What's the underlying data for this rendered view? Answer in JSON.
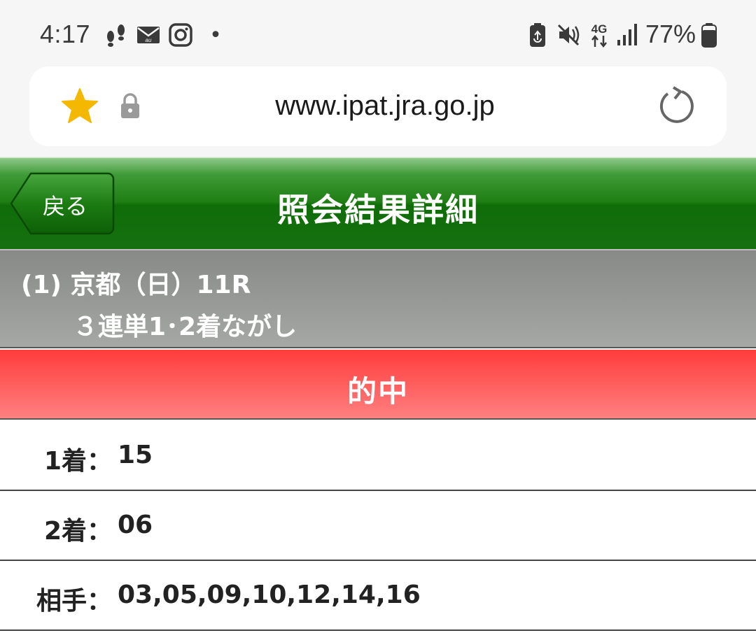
{
  "status_bar": {
    "time": "4:17",
    "battery_percent": "77%",
    "notification_dot": "•",
    "left_icons": [
      "footsteps-icon",
      "au-mail-icon",
      "instagram-icon"
    ],
    "right_icons": [
      "battery-saver-icon",
      "mute-vibrate-icon",
      "4g-data-icon",
      "signal-icon",
      "battery-icon"
    ],
    "network_label": "4G"
  },
  "browser": {
    "url": "www.ipat.jra.go.jp",
    "bookmark_color": "#f5b800"
  },
  "header": {
    "back_label": "戻る",
    "title": "照会結果詳細"
  },
  "race": {
    "line1": "(1) 京都（日）11R",
    "line2": "３連単1･2着ながし"
  },
  "result": {
    "label": "的中",
    "color": "#ff5050"
  },
  "rows": [
    {
      "label": "1着：",
      "value": "15"
    },
    {
      "label": "2着：",
      "value": "06"
    },
    {
      "label": "相手：",
      "value": "03,05,09,10,12,14,16"
    }
  ]
}
